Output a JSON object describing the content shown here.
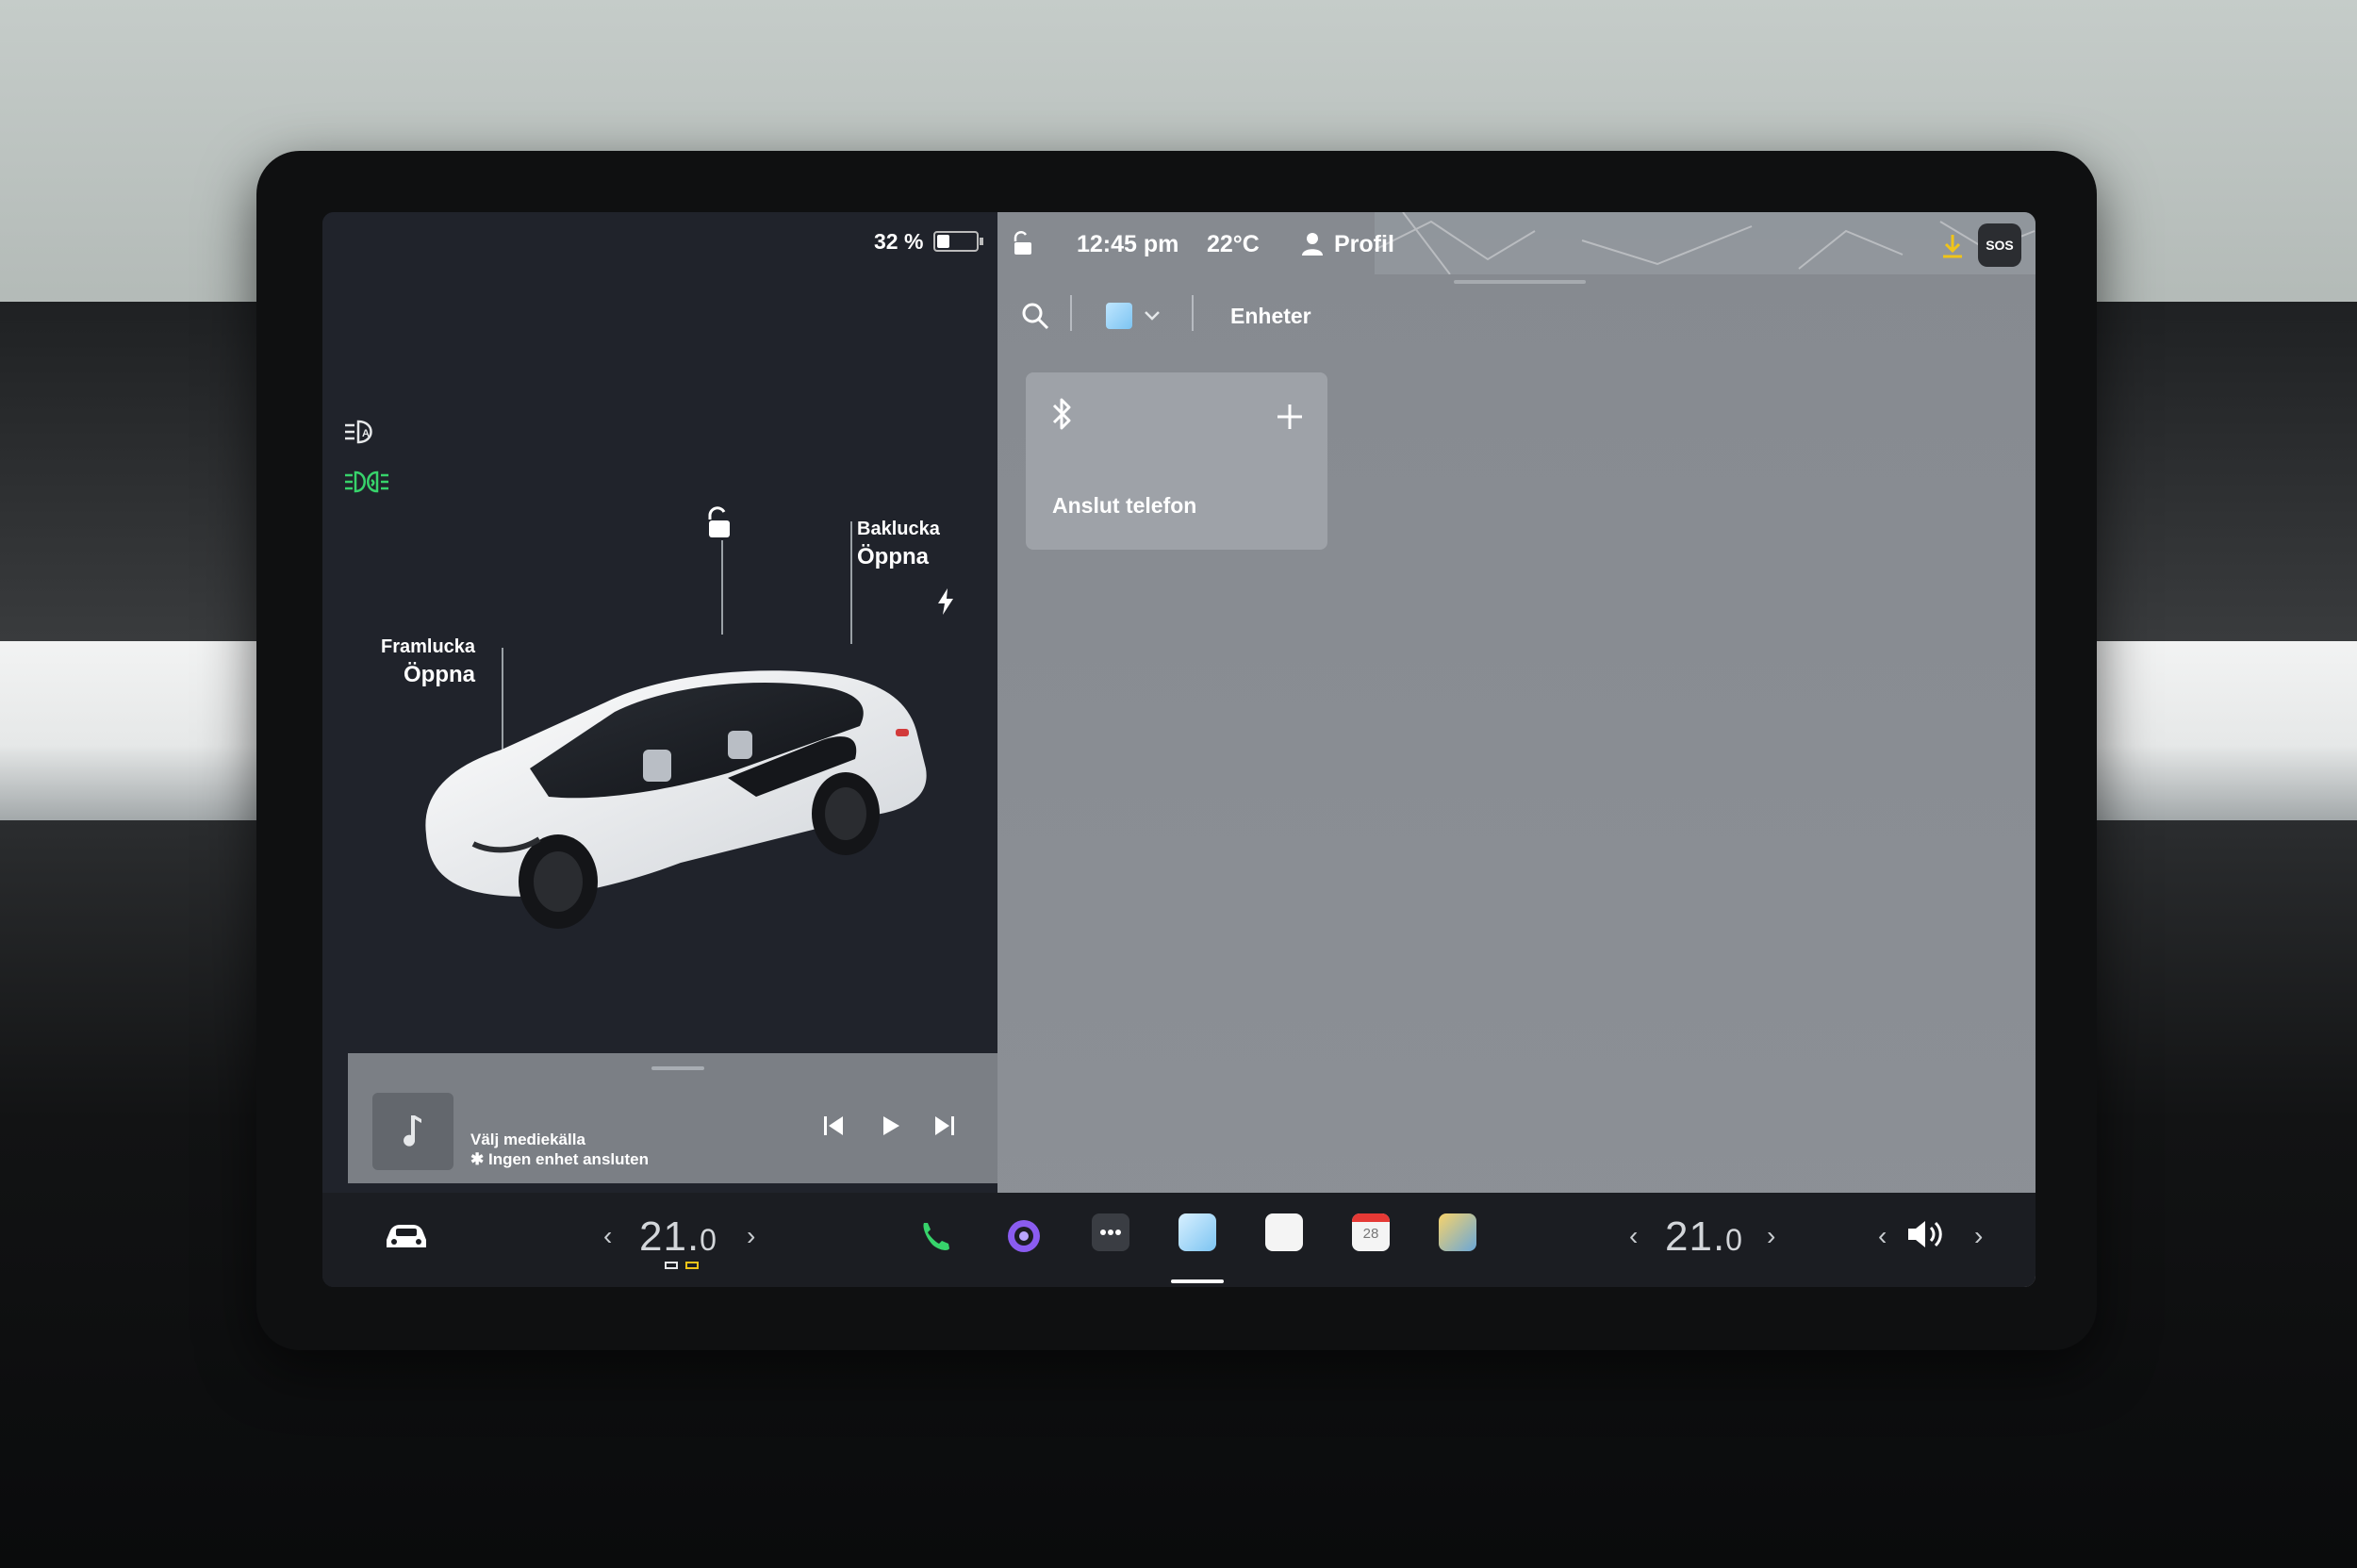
{
  "status": {
    "battery_percent": "32 %",
    "battery_level": 0.32,
    "time": "12:45 pm",
    "outside_temp": "22°C",
    "profile_label": "Profil"
  },
  "car": {
    "frunk": {
      "title": "Framlucka",
      "action": "Öppna"
    },
    "trunk": {
      "title": "Baklucka",
      "action": "Öppna"
    }
  },
  "media": {
    "title": "Välj mediekälla",
    "subtitle": "Ingen enhet ansluten"
  },
  "panel": {
    "tab_label": "Enheter",
    "card_label": "Anslut telefon"
  },
  "dock": {
    "driver_temp_main": "21.",
    "driver_temp_dec": "0",
    "passenger_temp_main": "21.",
    "passenger_temp_dec": "0",
    "calendar_day": "28"
  },
  "colors": {
    "accent_green": "#37d36b",
    "download_yellow": "#f0c419",
    "camera_purple": "#8a5cf0"
  }
}
